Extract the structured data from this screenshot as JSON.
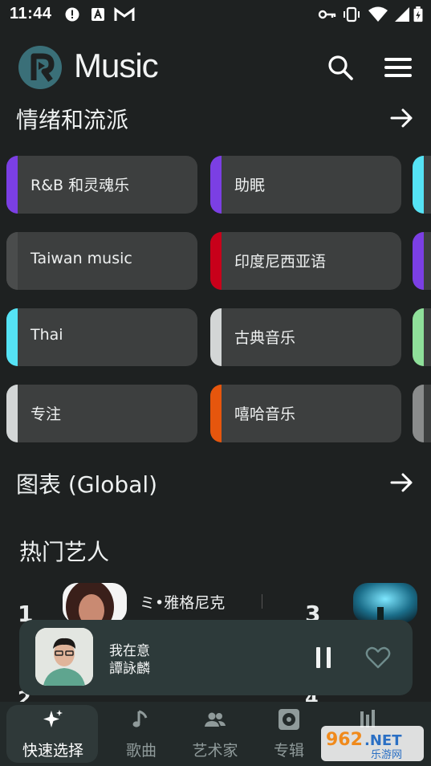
{
  "status_bar": {
    "time": "11:44"
  },
  "app": {
    "name": "Music"
  },
  "moods_section": {
    "title": "情绪和流派"
  },
  "genres": [
    {
      "label": "R&B 和灵魂乐",
      "color": "#7b3fe4"
    },
    {
      "label": "助眠",
      "color": "#7b3fe4"
    },
    {
      "label": "Taiwan music",
      "color": "#4a4c4c"
    },
    {
      "label": "印度尼西亚语",
      "color": "#c8001a"
    },
    {
      "label": "Thai",
      "color": "#55e3f5"
    },
    {
      "label": "古典音乐",
      "color": "#d3d6d6"
    },
    {
      "label": "专注",
      "color": "#d3d6d6"
    },
    {
      "label": "嘻哈音乐",
      "color": "#e6560d"
    }
  ],
  "genre_peek_colors": [
    "#55e3f5",
    "#7b3fe4",
    "#8fe09a",
    "#8a8c8c"
  ],
  "charts_section": {
    "title": "图表 (Global)"
  },
  "artists_section": {
    "title": "热门艺人",
    "ranks": [
      "1",
      "3"
    ],
    "visible_name": "ミ•雅格尼克"
  },
  "now_playing": {
    "title": "我在意",
    "artist": "譚詠麟"
  },
  "nav": {
    "items": [
      {
        "label": "快速选择",
        "icon": "sparkle-icon",
        "active": true
      },
      {
        "label": "歌曲",
        "icon": "music-note-icon",
        "active": false
      },
      {
        "label": "艺术家",
        "icon": "people-icon",
        "active": false
      },
      {
        "label": "专辑",
        "icon": "album-icon",
        "active": false
      }
    ]
  },
  "watermark": {
    "text": "962.NET",
    "sub": "乐游网"
  },
  "colors": {
    "background": "#1e2121",
    "card": "#3d3f3f",
    "mini_player": "#2d3a3a",
    "brand_teal": "#3a6f78"
  }
}
